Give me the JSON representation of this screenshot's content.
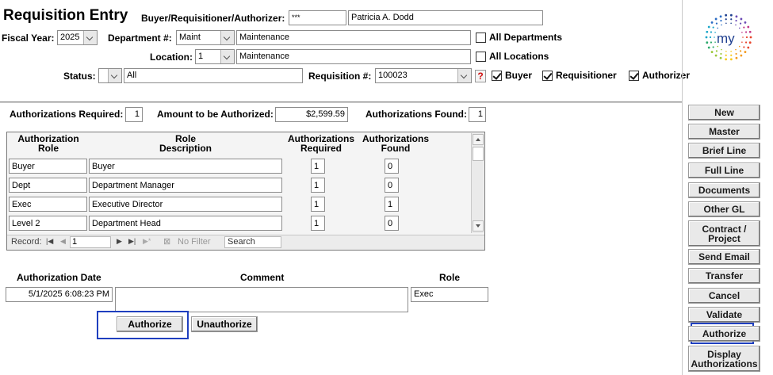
{
  "header": {
    "title": "Requisition Entry",
    "buyer_label": "Buyer/Requisitioner/Authorizer:",
    "buyer_code": "***",
    "buyer_name": "Patricia A. Dodd",
    "fiscal_year_label": "Fiscal Year:",
    "fiscal_year": "2025",
    "department_label": "Department #:",
    "department_code": "Maint",
    "department_name": "Maintenance",
    "all_departments_label": "All Departments",
    "location_label": "Location:",
    "location_code": "1",
    "location_name": "Maintenance",
    "all_locations_label": "All Locations",
    "status_label": "Status:",
    "status_code": "",
    "status_name": "All",
    "requisition_label": "Requisition #:",
    "requisition_number": "100023",
    "help_glyph": "?",
    "buyer_check_label": "Buyer",
    "requisitioner_check_label": "Requisitioner",
    "authorizer_check_label": "Authorizer",
    "logo_text": "my"
  },
  "summary": {
    "required_label": "Authorizations Required:",
    "required_value": "1",
    "amount_label": "Amount to be Authorized:",
    "amount_value": "$2,599.59",
    "found_label": "Authorizations Found:",
    "found_value": "1"
  },
  "grid": {
    "headers": {
      "role_line1": "Authorization",
      "role_line2": "Role",
      "desc_line1": "Role",
      "desc_line2": "Description",
      "req_line1": "Authorizations",
      "req_line2": "Required",
      "found_line1": "Authorizations",
      "found_line2": "Found"
    },
    "rows": [
      {
        "role": "Buyer",
        "description": "Buyer",
        "required": "1",
        "found": "0"
      },
      {
        "role": "Dept",
        "description": "Department Manager",
        "required": "1",
        "found": "0"
      },
      {
        "role": "Exec",
        "description": "Executive Director",
        "required": "1",
        "found": "1"
      },
      {
        "role": "Level 2",
        "description": "Department Head",
        "required": "1",
        "found": "0"
      }
    ],
    "nav": {
      "record_label": "Record:",
      "record_value": "1",
      "no_filter_label": "No Filter",
      "search_label": "Search"
    }
  },
  "detail": {
    "date_label": "Authorization Date",
    "comment_label": "Comment",
    "role_label": "Role",
    "date_value": "5/1/2025 6:08:23 PM",
    "comment_value": "",
    "role_value": "Exec",
    "authorize_label": "Authorize",
    "unauthorize_label": "Unauthorize"
  },
  "sidebar": {
    "new": "New",
    "master": "Master",
    "brief_line": "Brief Line",
    "full_line": "Full Line",
    "documents": "Documents",
    "other_gl": "Other GL",
    "contract_line1": "Contract /",
    "contract_line2": "Project",
    "send_email": "Send Email",
    "transfer": "Transfer",
    "cancel": "Cancel",
    "validate": "Validate",
    "authorize": "Authorize",
    "display_line1": "Display",
    "display_line2": "Authorizations"
  },
  "colors": {
    "highlight": "#1f3fbf",
    "separator": "#8a8a8a"
  }
}
